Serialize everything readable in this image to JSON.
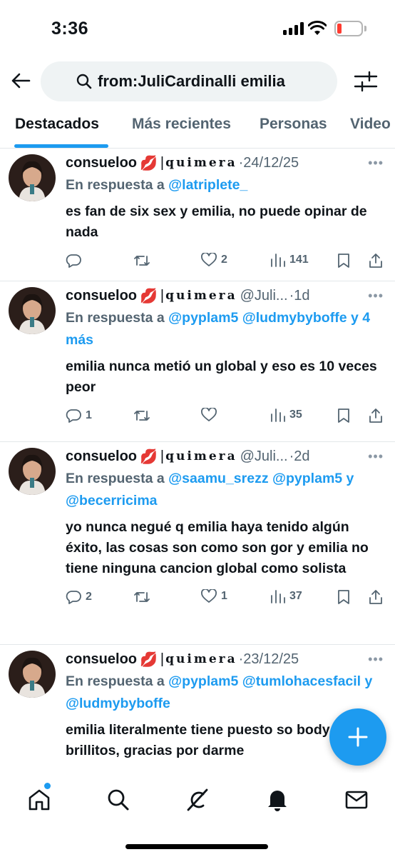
{
  "status": {
    "time": "3:36"
  },
  "search": {
    "query": "from:JuliCardinalli emilia"
  },
  "tabs": [
    {
      "label": "Destacados"
    },
    {
      "label": "Más recientes"
    },
    {
      "label": "Personas"
    },
    {
      "label": "Video"
    }
  ],
  "tweets": [
    {
      "name": "consueloo",
      "emoji": "💋",
      "divider": "|",
      "brand": "quimera",
      "handle": "",
      "dot": "·",
      "date": "24/12/25",
      "reply_prefix": "En respuesta a",
      "reply_mentions": "@latriplete_",
      "reply_extra": "",
      "text": "es fan de six sex y emilia, no puede opinar de nada",
      "replies": "",
      "likes": "2",
      "views": "141"
    },
    {
      "name": "consueloo",
      "emoji": "💋",
      "divider": "|",
      "brand": "quimera",
      "handle": "@Juli...",
      "dot": "·",
      "date": "1d",
      "reply_prefix": "En respuesta a",
      "reply_mentions": "@pyplam5 @ludmybyboffe y 4 más",
      "reply_extra": "",
      "text": "emilia nunca metió un global y eso es 10 veces peor",
      "replies": "1",
      "likes": "",
      "views": "35"
    },
    {
      "name": "consueloo",
      "emoji": "💋",
      "divider": "|",
      "brand": "quimera",
      "handle": "@Juli...",
      "dot": "·",
      "date": "2d",
      "reply_prefix": "En respuesta a",
      "reply_mentions": "@saamu_srezz @pyplam5 y @becerricima",
      "reply_extra": "",
      "text": "yo nunca negué q emilia haya tenido algún éxito, las cosas son como son gor y emilia no tiene ninguna cancion global como solista",
      "replies": "2",
      "likes": "1",
      "views": "37"
    },
    {
      "name": "consueloo",
      "emoji": "💋",
      "divider": "|",
      "brand": "quimera",
      "handle": "",
      "dot": "·",
      "date": "23/12/25",
      "reply_prefix": "En respuesta a",
      "reply_mentions": "@pyplam5 @tumlohacesfacil y @ludmybyboffe",
      "reply_extra": "",
      "text": "emilia literalmente tiene puesto so body con brillitos, gracias por darme",
      "replies": "",
      "likes": "",
      "views": ""
    }
  ],
  "icons": {
    "back": "arrow-left-icon",
    "search": "search-icon",
    "filter": "sliders-icon",
    "reply": "speech-bubble-icon",
    "retweet": "retweet-icon",
    "like": "heart-icon",
    "views": "bar-chart-icon",
    "bookmark": "bookmark-icon",
    "share": "share-icon",
    "compose": "plus-icon",
    "nav": [
      "home-icon",
      "search-icon",
      "grok-icon",
      "bell-icon",
      "mail-icon"
    ]
  },
  "colors": {
    "accent": "#1d9bf0",
    "muted": "#536471",
    "battery_low": "#ff3b30"
  }
}
